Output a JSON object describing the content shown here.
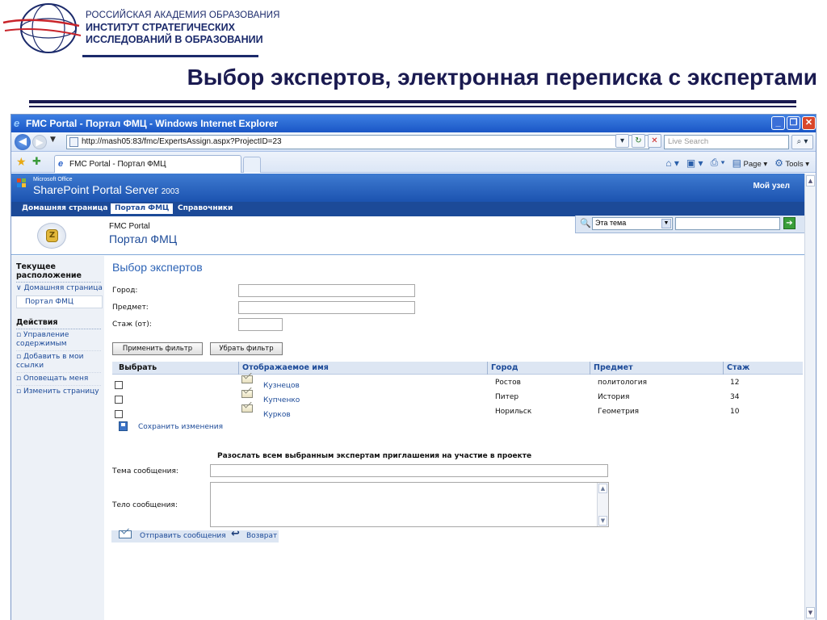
{
  "slide": {
    "org_line1": "РОССИЙСКАЯ АКАДЕМИЯ ОБРАЗОВАНИЯ",
    "org_line2": "ИНСТИТУТ СТРАТЕГИЧЕСКИХ",
    "org_line3": "ИССЛЕДОВАНИЙ В ОБРАЗОВАНИИ",
    "title": "Выбор экспертов, электронная переписка с экспертами"
  },
  "browser": {
    "window_title": "FMC Portal - Портал ФМЦ - Windows Internet Explorer",
    "url": "http://mash05:83/fmc/ExpertsAssign.aspx?ProjectID=23",
    "search_placeholder": "Live Search",
    "tab_label": "FMC Portal - Портал ФМЦ",
    "cmd_page": "Page",
    "cmd_tools": "Tools"
  },
  "sharepoint": {
    "ms_office": "Microsoft Office",
    "product": "SharePoint Portal Server",
    "product_year": "2003",
    "my_site": "Мой узел",
    "topnav": [
      "Домашняя страница",
      "Портал ФМЦ",
      "Справочники"
    ],
    "site_small": "FMC Portal",
    "site_large": "Портал ФМЦ",
    "scope_value": "Эта тема"
  },
  "left_nav": {
    "location_heading": "Текущее расположение",
    "home_link": "Домашняя страница",
    "current": "Портал ФМЦ",
    "actions_heading": "Действия",
    "action1": "Управление содержимым",
    "action2": "Добавить в мои ссылки",
    "action3": "Оповещать меня",
    "action4": "Изменить страницу"
  },
  "main": {
    "page_title": "Выбор экспертов",
    "city_label": "Город:",
    "subject_label": "Предмет:",
    "experience_label": "Стаж (от):",
    "apply_filter": "Применить фильтр",
    "remove_filter": "Убрать фильтр",
    "columns": [
      "Выбрать",
      "Отображаемое имя",
      "Город",
      "Предмет",
      "Стаж"
    ],
    "rows": [
      {
        "name": "Кузнецов",
        "city": "Ростов",
        "subject": "политология",
        "experience": "12"
      },
      {
        "name": "Купченко",
        "city": "Питер",
        "subject": "История",
        "experience": "34"
      },
      {
        "name": "Курков",
        "city": "Норильск",
        "subject": "Геометрия",
        "experience": "10"
      }
    ],
    "save_changes": "Сохранить изменения",
    "invite_text": "Разослать всем выбранным экспертам приглашения на участие в проекте",
    "msg_subject_label": "Тема сообщения:",
    "msg_body_label": "Тело сообщения:",
    "send_message": "Отправить сообщения",
    "back": "Возврат"
  }
}
